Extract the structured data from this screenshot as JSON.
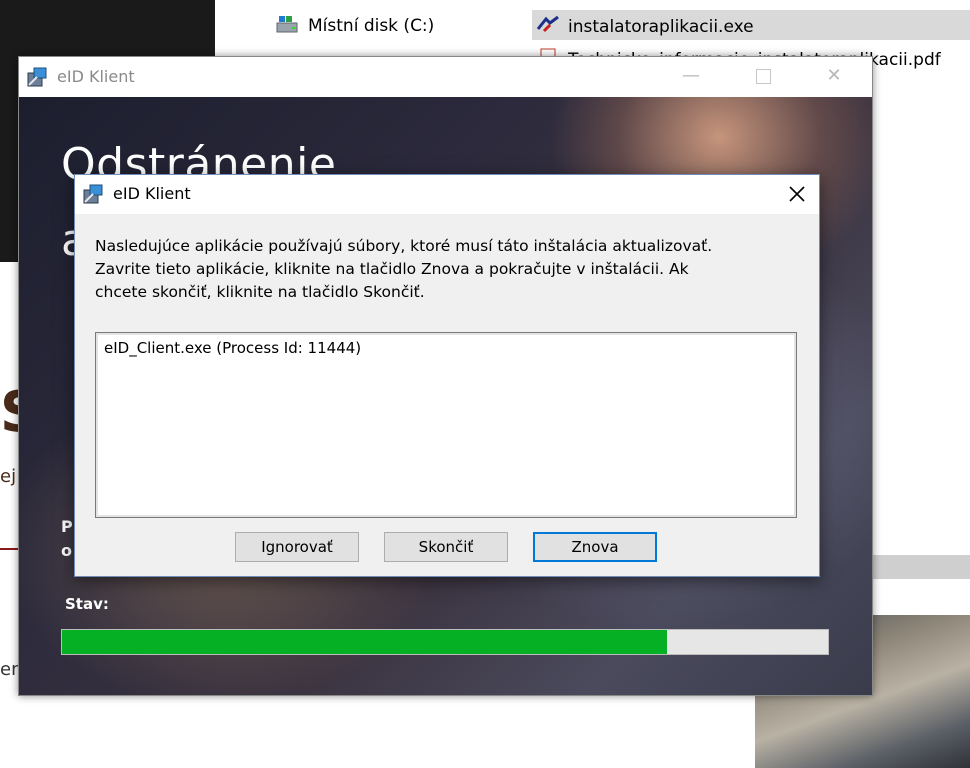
{
  "explorer": {
    "local_disk": "Místní disk (C:)",
    "file_exe": "instalatoraplikacii.exe",
    "file_pdf": "Technicke_informacie_instalatoraplikacii.pdf"
  },
  "background_side": {
    "letter_s": "S",
    "letter_e": "ej",
    "letter_en": "en"
  },
  "main_window": {
    "title": "eID Klient",
    "controls": {
      "minimize": "—",
      "close": "✕"
    },
    "heading_line1": "Odstránenie",
    "heading_line2": "a",
    "side_text": [
      "P",
      "o"
    ],
    "status_label": "Stav:",
    "progress_fraction": 0.79,
    "progress_color": "#06b025"
  },
  "dialog": {
    "title": "eID Klient",
    "message_lines": [
      "Nasledujúce aplikácie používajú súbory, ktoré musí táto inštalácia aktualizovať.",
      "Zavrite tieto aplikácie, kliknite na tlačidlo Znova a pokračujte v inštalácii. Ak",
      "chcete skončiť, kliknite na tlačidlo Skončiť."
    ],
    "processes": [
      "eID_Client.exe (Process Id: 11444)"
    ],
    "buttons": {
      "ignore": "Ignorovať",
      "cancel": "Skončiť",
      "retry": "Znova"
    },
    "focus_color": "#0078d7"
  },
  "icons": {
    "app": "installer-package-icon",
    "disk": "drive-icon",
    "exe": "installer-exe-icon",
    "pdf": "pdf-file-icon",
    "close": "close-icon"
  }
}
